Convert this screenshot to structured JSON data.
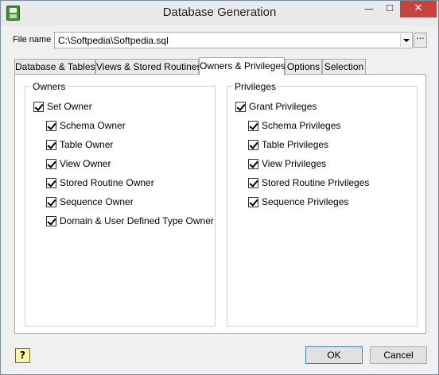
{
  "window": {
    "title": "Database Generation",
    "minimize_glyph": "—",
    "maximize_glyph": "☐",
    "close_glyph": "✕"
  },
  "file": {
    "label": "File name",
    "value": "C:\\Softpedia\\Softpedia.sql",
    "browse_label": "···"
  },
  "tabs": [
    {
      "label": "Database & Tables"
    },
    {
      "label": "Views & Stored Routines"
    },
    {
      "label": "Owners & Privileges",
      "active": true
    },
    {
      "label": "Options"
    },
    {
      "label": "Selection"
    }
  ],
  "owners": {
    "legend": "Owners",
    "set_owner": "Set Owner",
    "items": [
      {
        "label": "Schema Owner",
        "checked": true
      },
      {
        "label": "Table Owner",
        "checked": true
      },
      {
        "label": "View Owner",
        "checked": true
      },
      {
        "label": "Stored Routine Owner",
        "checked": true
      },
      {
        "label": "Sequence Owner",
        "checked": true
      },
      {
        "label": "Domain & User Defined Type Owner",
        "checked": true
      }
    ]
  },
  "privileges": {
    "legend": "Privileges",
    "grant_privileges": "Grant Privileges",
    "items": [
      {
        "label": "Schema Privileges",
        "checked": true
      },
      {
        "label": "Table Privileges",
        "checked": true
      },
      {
        "label": "View Privileges",
        "checked": true
      },
      {
        "label": "Stored Routine Privileges",
        "checked": true
      },
      {
        "label": "Sequence Privileges",
        "checked": true
      }
    ]
  },
  "buttons": {
    "help": "?",
    "ok": "OK",
    "cancel": "Cancel"
  },
  "colors": {
    "close_button": "#c7443e",
    "ok_border": "#3c7fb1"
  }
}
